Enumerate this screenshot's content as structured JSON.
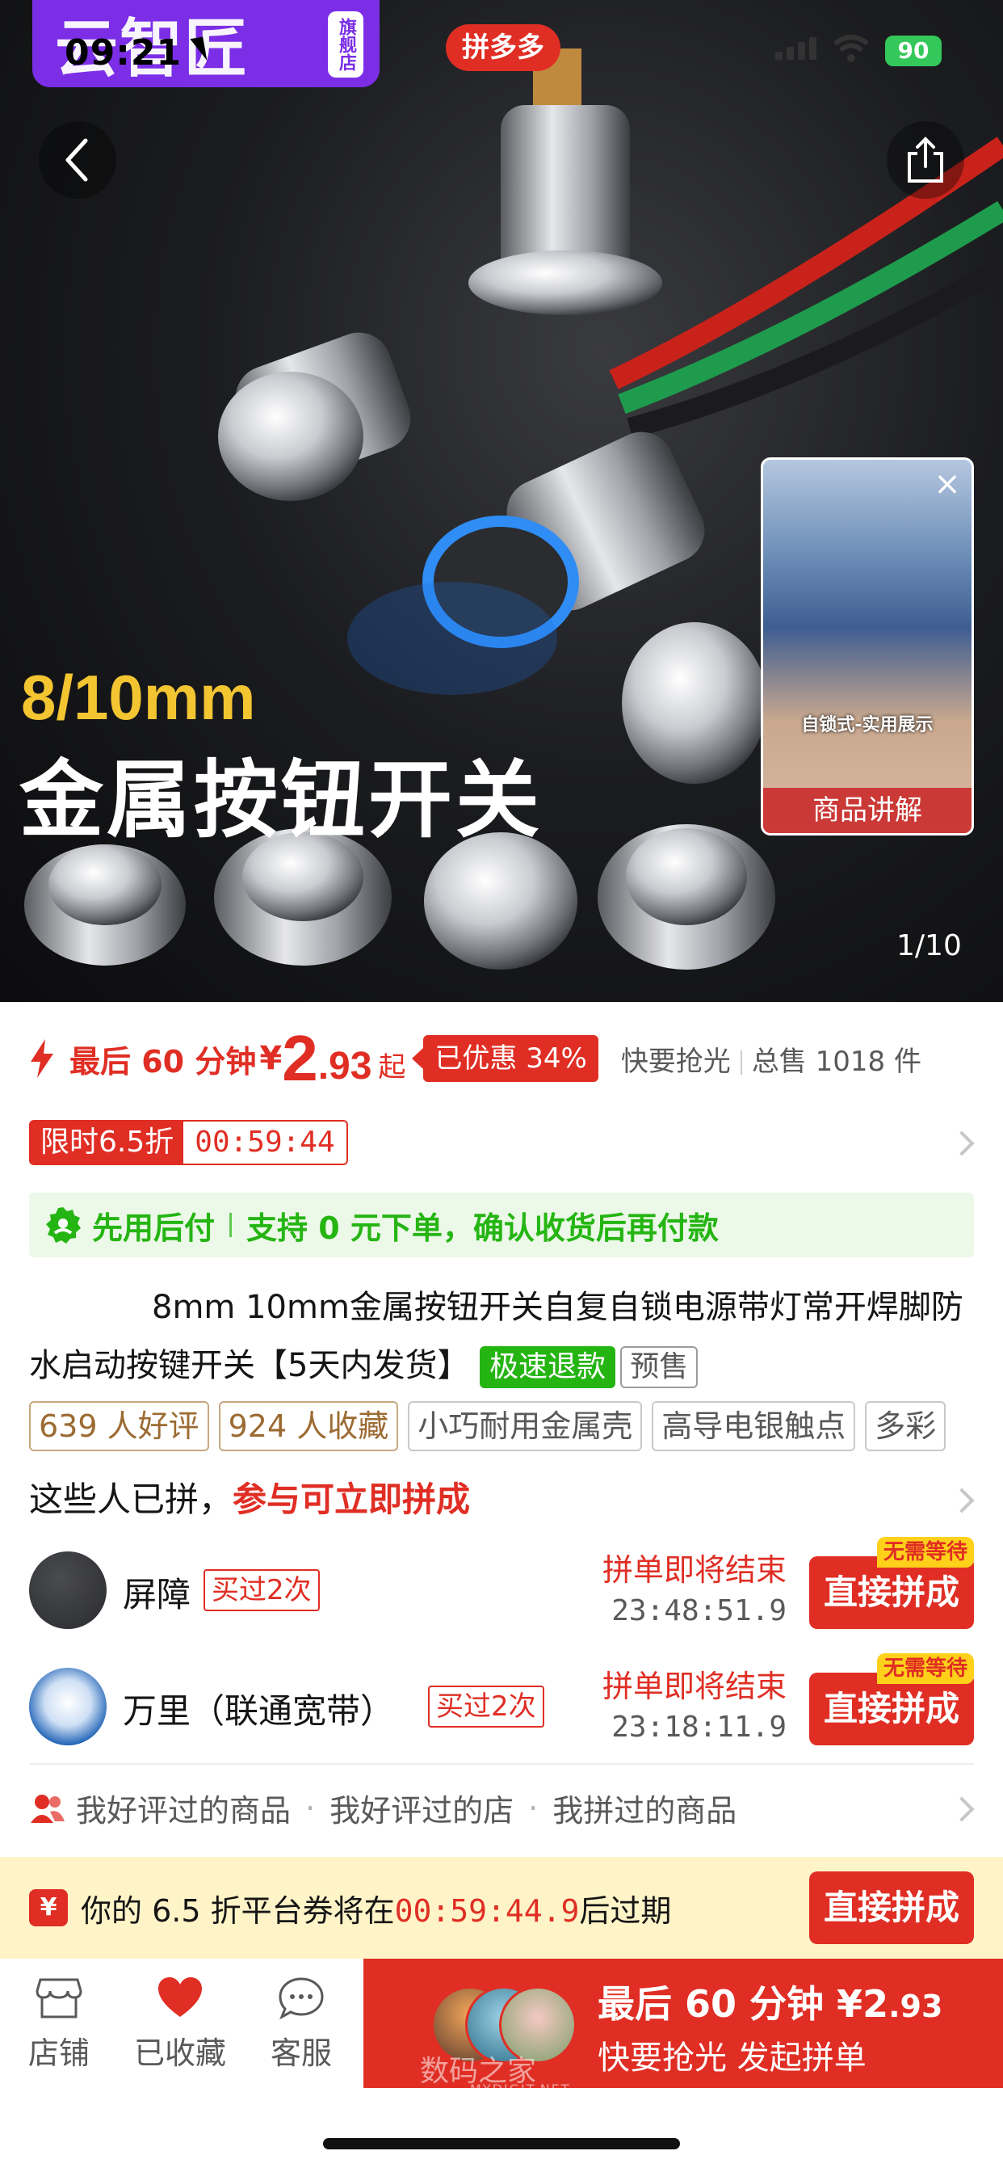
{
  "status_bar": {
    "time": "09:21",
    "battery": "90"
  },
  "header": {
    "app_logo": "拼多多",
    "brand_name": "云智匠",
    "brand_badge": "旗舰店",
    "back_icon": "back-arrow-icon",
    "share_icon": "share-icon"
  },
  "hero": {
    "size_text": "8/10mm",
    "title": "金属按钮开关",
    "page_indicator": "1/10",
    "video": {
      "caption": "自锁式-实用展示",
      "label": "商品讲解"
    }
  },
  "price": {
    "prefix": "最后 60 分钟",
    "currency": "¥",
    "integer": "2",
    "decimal": ".93",
    "suffix": "起",
    "discount": "已优惠 34%",
    "stock_text": "快要抢光",
    "total_sales": "总售 1018 件"
  },
  "limited": {
    "label": "限时6.5折",
    "countdown": "00:59:44"
  },
  "credit": {
    "label": "先用后付",
    "desc": "支持 0 元下单，确认收货后再付款"
  },
  "product": {
    "title": "8mm 10mm金属按钮开关自复自锁电源带灯常开焊脚防水启动按键开关【5天内发货】",
    "tag_refund": "极速退款",
    "tag_presale": "预售"
  },
  "chips": [
    "639 人好评",
    "924 人收藏",
    "小巧耐用金属壳",
    "高导电银触点",
    "多彩"
  ],
  "group": {
    "header_prefix": "这些人已拼，",
    "header_highlight": "参与可立即拼成",
    "items": [
      {
        "name": "屏障",
        "bought": "买过2次",
        "ending_label": "拼单即将结束",
        "ending_time": "23:48:51.9",
        "badge": "无需等待",
        "button": "直接拼成"
      },
      {
        "name": "万里（联通宽带）",
        "bought": "买过2次",
        "ending_label": "拼单即将结束",
        "ending_time": "23:18:11.9",
        "badge": "无需等待",
        "button": "直接拼成"
      }
    ]
  },
  "history": [
    "我好评过的商品",
    "我好评过的店",
    "我拼过的商品"
  ],
  "coupon": {
    "icon": "¥",
    "text_prefix": "你的 6.5 折平台券将在",
    "time": "00:59:44.9",
    "text_suffix": "后过期",
    "button": "直接拼成"
  },
  "bottom": {
    "tabs": [
      {
        "label": "店铺",
        "icon": "store-icon"
      },
      {
        "label": "已收藏",
        "icon": "heart-icon"
      },
      {
        "label": "客服",
        "icon": "chat-icon"
      }
    ],
    "buy": {
      "line1_prefix": "最后 60 分钟 ¥2",
      "line1_decimal": ".93",
      "line2": "快要抢光 发起拼单"
    },
    "watermark": "数码之家",
    "watermark_sub": "MYDIGIT.NET"
  },
  "colors": {
    "accent": "#e02e24",
    "credit_green": "#25b513",
    "brand_purple": "#7b2ee6",
    "coupon_bg": "#fff4c7"
  }
}
